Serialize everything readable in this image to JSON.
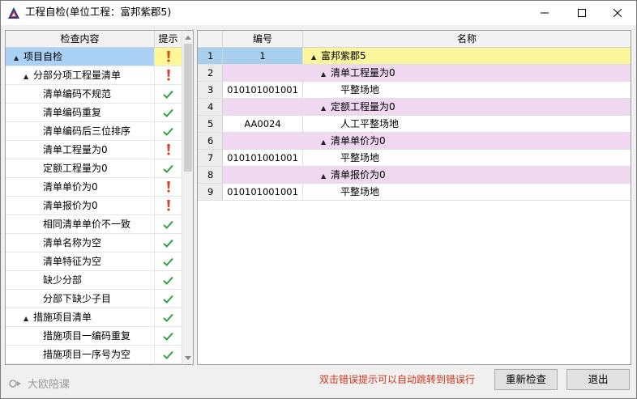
{
  "window": {
    "title": "工程自检(单位工程：富邦紫郡5)",
    "controls": [
      "minimize",
      "maximize",
      "close"
    ]
  },
  "left_panel": {
    "headers": {
      "content": "检查内容",
      "tip": "提示"
    },
    "rows": [
      {
        "label": "项目自检",
        "level": 0,
        "expander": "▲",
        "status": "warning"
      },
      {
        "label": "分部分项工程量清单",
        "level": 1,
        "expander": "▲",
        "status": "warning"
      },
      {
        "label": "清单编码不规范",
        "level": 2,
        "expander": "",
        "status": "ok"
      },
      {
        "label": "清单编码重复",
        "level": 2,
        "expander": "",
        "status": "ok"
      },
      {
        "label": "清单编码后三位排序",
        "level": 2,
        "expander": "",
        "status": "ok"
      },
      {
        "label": "清单工程量为0",
        "level": 2,
        "expander": "",
        "status": "warning"
      },
      {
        "label": "定额工程量为0",
        "level": 2,
        "expander": "",
        "status": "ok"
      },
      {
        "label": "清单单价为0",
        "level": 2,
        "expander": "",
        "status": "warning"
      },
      {
        "label": "清单报价为0",
        "level": 2,
        "expander": "",
        "status": "warning"
      },
      {
        "label": "相同清单单价不一致",
        "level": 2,
        "expander": "",
        "status": "ok"
      },
      {
        "label": "清单名称为空",
        "level": 2,
        "expander": "",
        "status": "ok"
      },
      {
        "label": "清单特征为空",
        "level": 2,
        "expander": "",
        "status": "ok"
      },
      {
        "label": "缺少分部",
        "level": 2,
        "expander": "",
        "status": "ok"
      },
      {
        "label": "分部下缺少子目",
        "level": 2,
        "expander": "",
        "status": "ok"
      },
      {
        "label": "措施项目清单",
        "level": 1,
        "expander": "▲",
        "status": "ok"
      },
      {
        "label": "措施项目一编码重复",
        "level": 2,
        "expander": "",
        "status": "ok"
      },
      {
        "label": "措施项目一序号为空",
        "level": 2,
        "expander": "",
        "status": "ok"
      }
    ]
  },
  "right_panel": {
    "headers": {
      "rownum": "",
      "code": "编号",
      "name": "名称"
    },
    "rows": [
      {
        "num": "1",
        "code": "1",
        "name": "富邦紫郡5",
        "kind": "root",
        "expander": "▲",
        "indent": 0
      },
      {
        "num": "2",
        "code": "",
        "name": "清单工程量为0",
        "kind": "group",
        "expander": "▲",
        "indent": 1
      },
      {
        "num": "3",
        "code": "010101001001",
        "name": "平整场地",
        "kind": "item",
        "expander": "",
        "indent": 2
      },
      {
        "num": "4",
        "code": "",
        "name": "定额工程量为0",
        "kind": "group",
        "expander": "▲",
        "indent": 1
      },
      {
        "num": "5",
        "code": "AA0024",
        "name": "人工平整场地",
        "kind": "item",
        "expander": "",
        "indent": 2
      },
      {
        "num": "6",
        "code": "",
        "name": "清单单价为0",
        "kind": "group",
        "expander": "▲",
        "indent": 1
      },
      {
        "num": "7",
        "code": "010101001001",
        "name": "平整场地",
        "kind": "item",
        "expander": "",
        "indent": 2
      },
      {
        "num": "8",
        "code": "",
        "name": "清单报价为0",
        "kind": "group",
        "expander": "▲",
        "indent": 1
      },
      {
        "num": "9",
        "code": "010101001001",
        "name": "平整场地",
        "kind": "item",
        "expander": "",
        "indent": 2
      }
    ]
  },
  "footer": {
    "hint": "双击错误提示可以自动跳转到错误行",
    "recheck_label": "重新检查",
    "exit_label": "退出",
    "watermark": "大欧陪课"
  },
  "colors": {
    "warning": "#e04024",
    "ok": "#2ea043",
    "selected_name_bg": "#aad2f7",
    "selected_tip_bg": "#fdf797",
    "group_row_bg": "#f0d8f0",
    "hint_text": "#d0361d"
  },
  "icons": {
    "app": "app-logo-icon",
    "warning": "exclamation-icon",
    "ok": "check-icon",
    "expander": "expand-triangle-icon"
  }
}
